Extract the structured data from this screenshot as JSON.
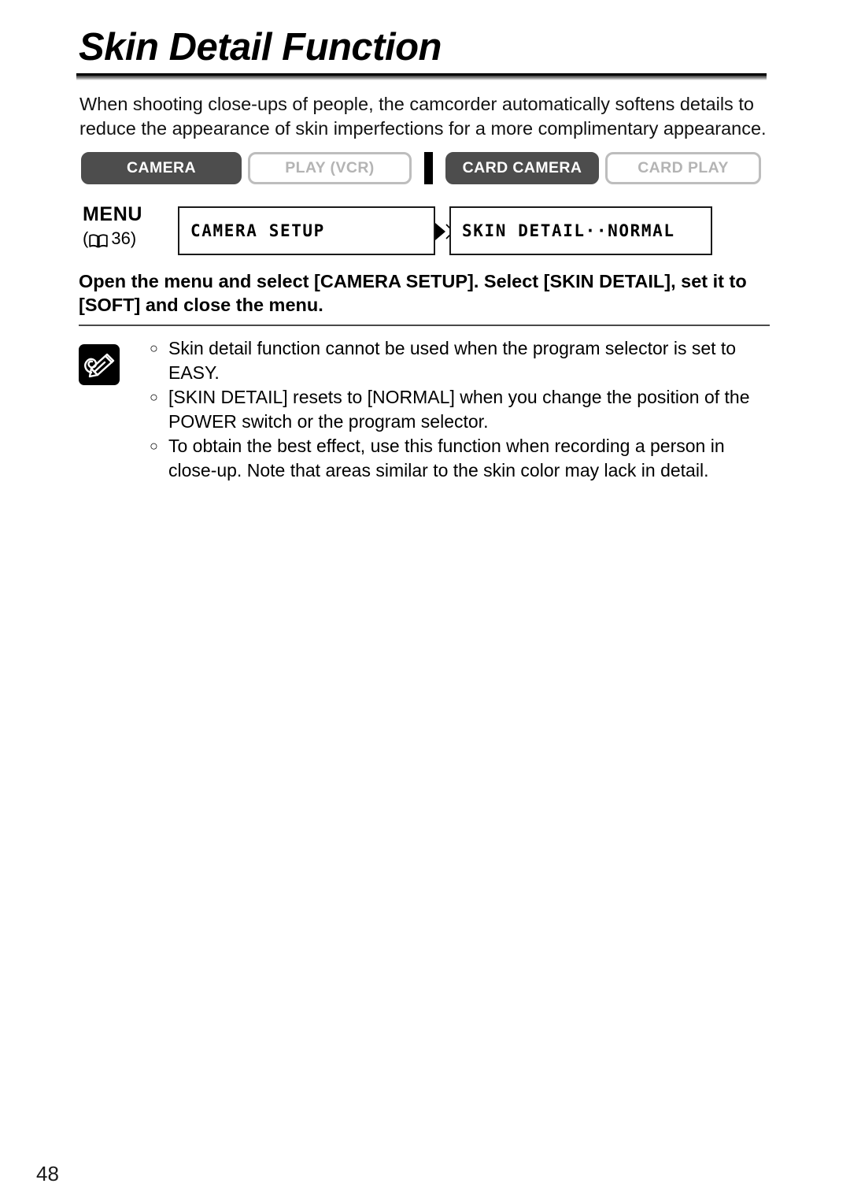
{
  "page": {
    "title": "Skin Detail Function",
    "number": "48"
  },
  "intro": {
    "text": "When shooting close-ups of people, the camcorder automatically softens details to reduce the appearance of skin imperfections for a more complimentary appearance."
  },
  "modes": {
    "items": [
      {
        "label": "CAMERA",
        "state": "active"
      },
      {
        "label": "PLAY (VCR)",
        "state": "inactive"
      },
      {
        "label": "CARD CAMERA",
        "state": "active"
      },
      {
        "label": "CARD PLAY",
        "state": "inactive"
      }
    ]
  },
  "menu": {
    "label": "MENU",
    "reference_icon": "open-book-icon",
    "reference_open": "(",
    "reference_page": "36",
    "reference_close": ")",
    "arrow_icon": "double-right-arrow-icon",
    "boxes": [
      {
        "text": "CAMERA SETUP"
      },
      {
        "text": "SKIN DETAIL··NORMAL"
      }
    ]
  },
  "instruction": {
    "text": "Open the menu and select [CAMERA SETUP]. Select [SKIN DETAIL], set it to [SOFT] and close the menu."
  },
  "notes": {
    "icon": "memo-pencil-icon",
    "bullet": "○",
    "items": [
      {
        "text": "Skin detail function cannot be used when the program selector is set to EASY."
      },
      {
        "text": "[SKIN DETAIL] resets to [NORMAL] when you change the position of the POWER switch or the program selector."
      },
      {
        "text": "To obtain the best effect, use this function when recording a person in close-up. Note that areas similar to the skin color may lack in detail."
      }
    ]
  },
  "colors": {
    "active_pill": "#4d4d4d",
    "inactive_border": "#bdbdbd",
    "inactive_text": "#b4b4b4",
    "rule": "#000000"
  }
}
